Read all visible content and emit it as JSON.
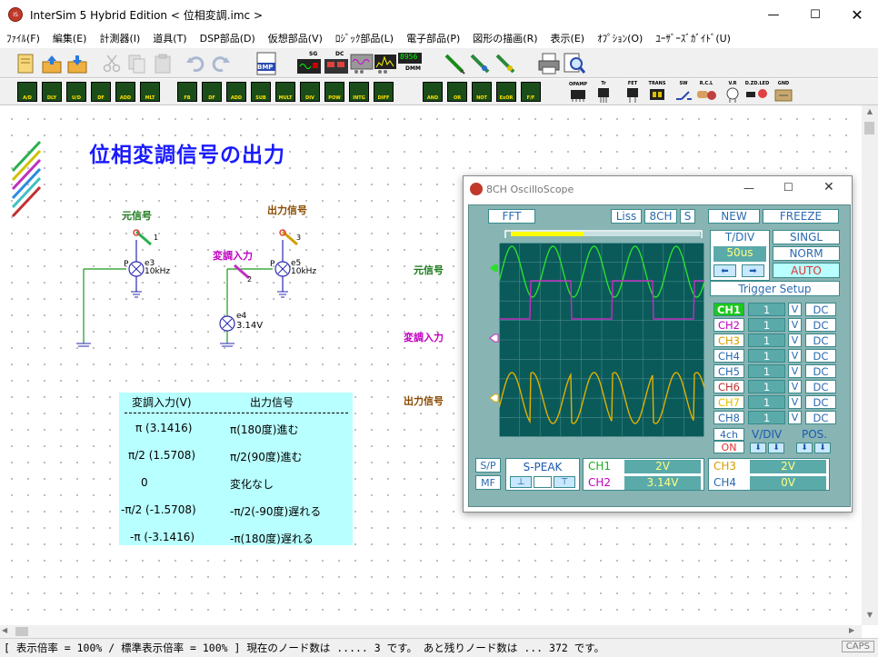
{
  "window": {
    "title": "InterSim 5  Hybrid Edition  < 位相変調.imc >"
  },
  "menu": [
    "ﾌｧｲﾙ(F)",
    "編集(E)",
    "計測器(I)",
    "道具(T)",
    "DSP部品(D)",
    "仮想部品(V)",
    "ﾛｼﾞｯｸ部品(L)",
    "電子部品(P)",
    "図形の描画(R)",
    "表示(E)",
    "ｵﾌﾟｼｮﾝ(O)",
    "ﾕｰｻﾞｰｽﾞｶﾞｲﾄﾞ(U)"
  ],
  "toolbar1": {
    "bmp": "BMP",
    "sg": "SG",
    "dc": "DC",
    "dmm": "DMM",
    "meter": "8956"
  },
  "toolbar2": {
    "dsp": [
      "A/D",
      "DLY",
      "U/D",
      "DF",
      "ADD",
      "MLT"
    ],
    "virt": [
      "FB",
      "DF",
      "ADD",
      "SUB",
      "MULT",
      "DIV",
      "POW",
      "INTG",
      "DIFF"
    ],
    "logic": [
      "AND",
      "OR",
      "NOT",
      "ExOR",
      "F/F"
    ],
    "parts": [
      "OPAMP",
      "Tr",
      "FET",
      "TRANS",
      "SW",
      "R.C.L",
      "V.R",
      "D.ZD.LED",
      "GND"
    ]
  },
  "canvas": {
    "heading": "位相変調信号の出力",
    "label_source": "元信号",
    "label_output": "出力信号",
    "label_mod": "変調入力",
    "comp_e3": "e3",
    "comp_e3_freq": "10kHz",
    "comp_e5": "e5",
    "comp_e5_freq": "10kHz",
    "comp_e4": "e4",
    "comp_e4_val": "3.14V",
    "pin_p": "P",
    "pin_1": "1",
    "pin_3": "3",
    "pin_2": "2",
    "scope_ch1": "元信号",
    "scope_ch2": "変調入力",
    "scope_ch3": "出力信号"
  },
  "phase_table": {
    "header": [
      "変調入力(V)",
      "出力信号"
    ],
    "rows": [
      [
        "π (3.1416)",
        "π(180度)進む"
      ],
      [
        "π/2 (1.5708)",
        "π/2(90度)進む"
      ],
      [
        "0",
        "変化なし"
      ],
      [
        "-π/2 (-1.5708)",
        "-π/2(-90度)遅れる"
      ],
      [
        "-π (-3.1416)",
        "-π(180度)遅れる"
      ]
    ]
  },
  "scope": {
    "title": "8CH OscilloScope",
    "fft": "FFT",
    "liss": "Liss",
    "ch8": "8CH",
    "s": "S",
    "new": "NEW",
    "freeze": "FREEZE",
    "tdiv_label": "T/DIV",
    "tdiv_value": "50us",
    "single": "SINGL",
    "norm": "NORM",
    "auto": "AUTO",
    "trigger": "Trigger Setup",
    "channels": [
      {
        "name": "CH1",
        "volts": "1",
        "unit": "V",
        "coupling": "DC",
        "color": "#00c000"
      },
      {
        "name": "CH2",
        "volts": "1",
        "unit": "V",
        "coupling": "DC",
        "color": "#c000c0"
      },
      {
        "name": "CH3",
        "volts": "1",
        "unit": "V",
        "coupling": "DC",
        "color": "#d4a000"
      },
      {
        "name": "CH4",
        "volts": "1",
        "unit": "V",
        "coupling": "DC",
        "color": "#2a6ab0"
      },
      {
        "name": "CH5",
        "volts": "1",
        "unit": "V",
        "coupling": "DC",
        "color": "#2a6ab0"
      },
      {
        "name": "CH6",
        "volts": "1",
        "unit": "V",
        "coupling": "DC",
        "color": "#c03030"
      },
      {
        "name": "CH7",
        "volts": "1",
        "unit": "V",
        "coupling": "DC",
        "color": "#e0c000"
      },
      {
        "name": "CH8",
        "volts": "1",
        "unit": "V",
        "coupling": "DC",
        "color": "#2a6ab0"
      }
    ],
    "mode4ch": "4ch",
    "on": "ON",
    "vdiv": "V/DIV",
    "pos": "POS.",
    "sp": "S/P",
    "mf": "MF",
    "speak": "S-PEAK",
    "readouts": [
      {
        "ch": "CH1",
        "val": "2V"
      },
      {
        "ch": "CH2",
        "val": "3.14V"
      },
      {
        "ch": "CH3",
        "val": "2V"
      },
      {
        "ch": "CH4",
        "val": "0V"
      }
    ]
  },
  "status": {
    "text": "[ 表示倍率 = 100% / 標準表示倍率 = 100% ] 現在のノード数は ..... 3 です。 あと残りノード数は ... 372 です。",
    "caps": "CAPS"
  }
}
